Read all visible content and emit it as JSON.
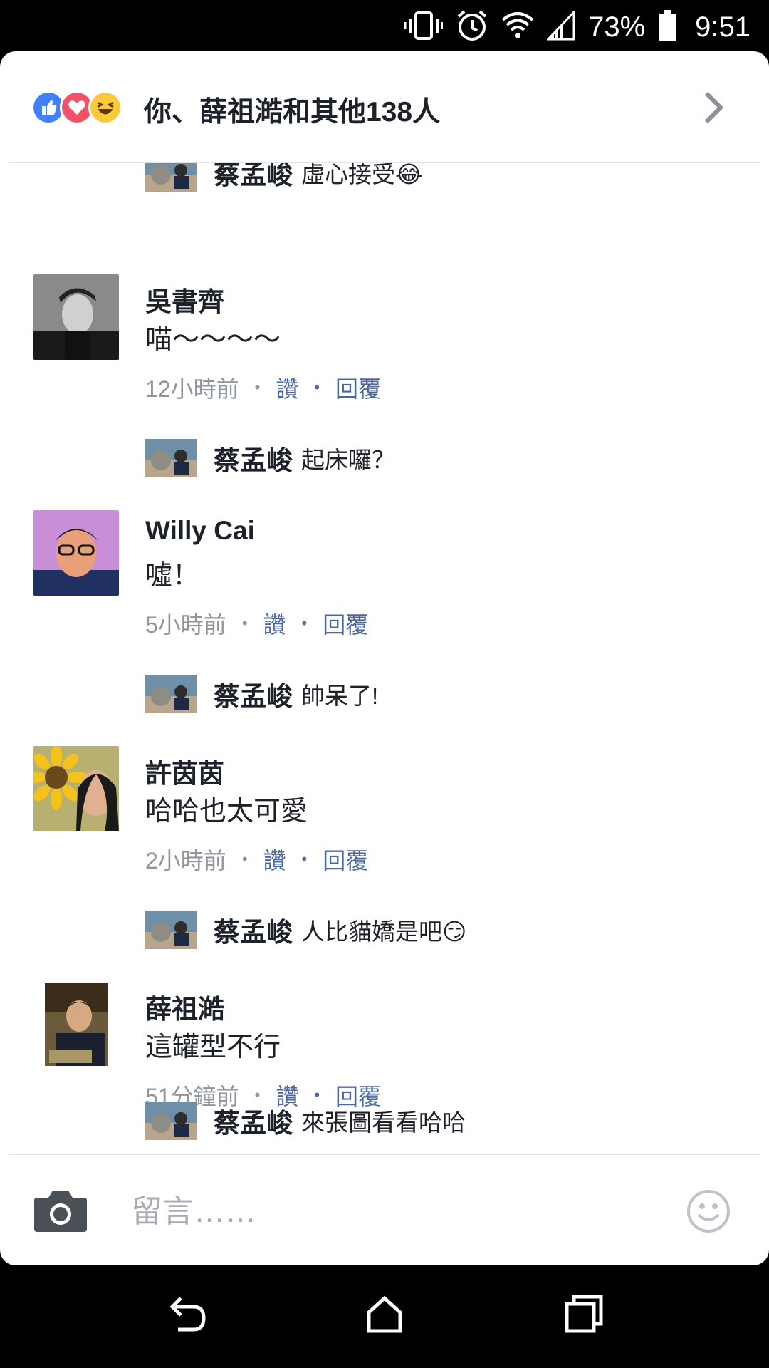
{
  "status": {
    "battery": "73%",
    "time": "9:51"
  },
  "reactions": {
    "summary": "你、薛祖澔和其他138人"
  },
  "comments": [
    {
      "name": "吳書齊",
      "body": "喵～～～～",
      "time": "12小時前",
      "like": "讚",
      "reply": "回覆"
    },
    {
      "name": "Willy Cai",
      "body": "噓！",
      "time": "5小時前",
      "like": "讚",
      "reply": "回覆"
    },
    {
      "name": "許茵茵",
      "body": "哈哈也太可愛",
      "time": "2小時前",
      "like": "讚",
      "reply": "回覆"
    },
    {
      "name": "薛祖澔",
      "body": "這罐型不行",
      "time": "51分鐘前",
      "like": "讚",
      "reply": "回覆"
    }
  ],
  "replies": [
    {
      "name": "蔡孟峻",
      "text": "虛心接受😂"
    },
    {
      "name": "蔡孟峻",
      "text": "起床囉？"
    },
    {
      "name": "蔡孟峻",
      "text": "帥呆了!"
    },
    {
      "name": "蔡孟峻",
      "text": "人比貓嬌是吧😏"
    },
    {
      "name": "蔡孟峻",
      "text": "來張圖看看哈哈"
    }
  ],
  "composer": {
    "placeholder": "留言……"
  },
  "colors": {
    "like": "#4080ff",
    "love": "#f25268",
    "haha": "#fcc93d",
    "name": "#1d2129",
    "meta": "#90949c",
    "link": "#4b67a1"
  },
  "icons": [
    "vibrate-icon",
    "alarm-icon",
    "wifi-icon",
    "signal-icon",
    "battery-icon",
    "like-reaction-icon",
    "love-reaction-icon",
    "haha-reaction-icon",
    "chevron-right-icon",
    "camera-icon",
    "smiley-icon",
    "back-icon",
    "home-icon",
    "recents-icon"
  ]
}
